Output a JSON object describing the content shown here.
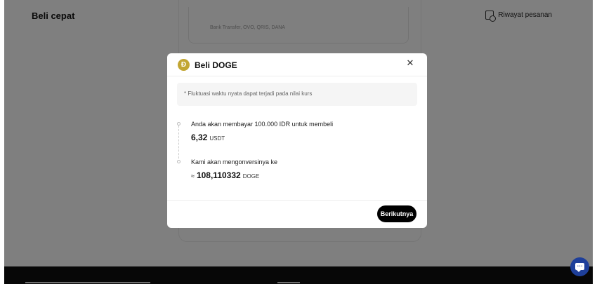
{
  "page": {
    "title": "Beli cepat",
    "history_label": "Riwayat pesanan",
    "payment_methods_hint": "Bank Transfer, OVO, QRIS, DANA"
  },
  "modal": {
    "title": "Beli DOGE",
    "coin_icon": "doge-coin-icon",
    "close_icon": "close-icon",
    "notice": "* Fluktuasi waktu nyata dapat terjadi pada nilai kurs",
    "pay_label": "Anda akan membayar 100.000 IDR untuk membeli",
    "pay_amount": "6,32",
    "pay_unit": "USDT",
    "convert_label": "Kami akan mengonversinya ke",
    "convert_prefix": "≈",
    "convert_amount": "108,110332",
    "convert_unit": "DOGE",
    "next_button": "Berikutnya"
  },
  "chat": {
    "icon": "chat-icon"
  },
  "colors": {
    "overlay": "#000000",
    "button": "#000000",
    "chat": "#1e3f9a",
    "doge": "#c2a633"
  }
}
